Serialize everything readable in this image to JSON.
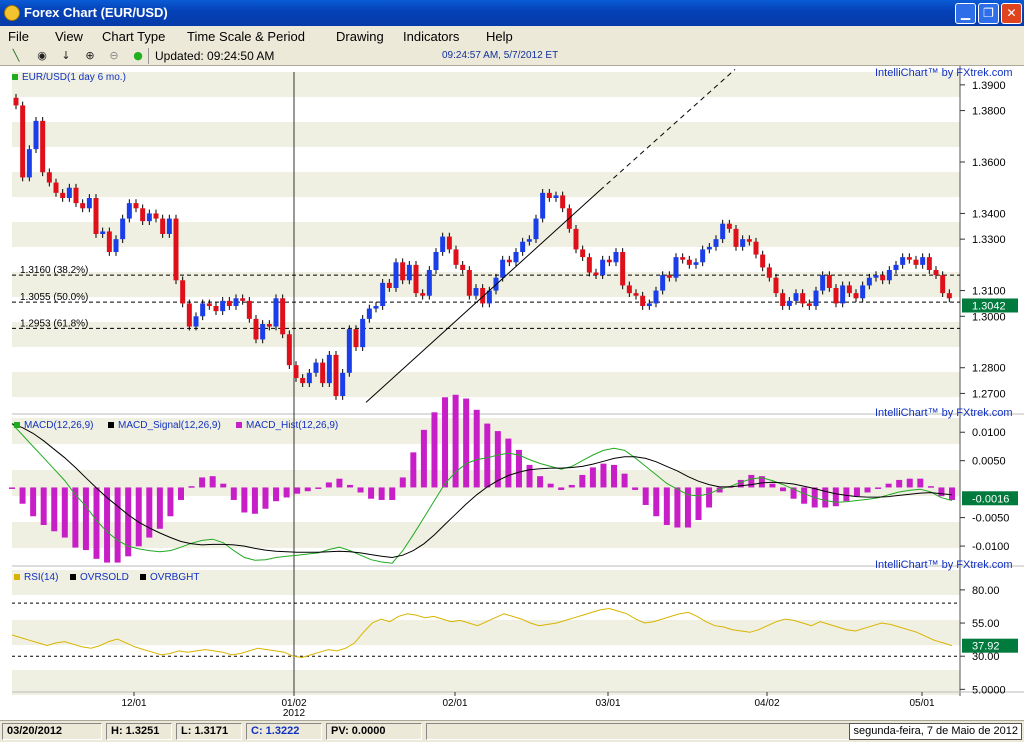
{
  "window": {
    "title": "Forex Chart (EUR/USD)",
    "min_icon": "minimize-icon",
    "max_icon": "maximize-icon",
    "close_icon": "close-icon"
  },
  "menu": [
    "File",
    "View",
    "Chart Type",
    "Time Scale & Period",
    "Drawing",
    "Indicators",
    "Help"
  ],
  "toolbar": {
    "updated": "Updated: 09:24:50 AM",
    "clock": "09:24:57 AM, 5/7/2012 ET",
    "icons": [
      "trendline-icon",
      "crosshair-icon",
      "arrow-down-icon",
      "zoom-in-icon",
      "zoom-out-icon",
      "live-dot-icon"
    ]
  },
  "brand": "IntelliChart™ by FXtrek.com",
  "price_panel": {
    "legend": "EUR/USD(1 day  6 mo.)",
    "fib": [
      "1.3160 (38.2%)",
      "1.3055 (50.0%)",
      "1.2953 (61.8%)"
    ],
    "fib_values": [
      1.316,
      1.3055,
      1.2953
    ],
    "ticks": [
      "1.3900",
      "1.3800",
      "1.3600",
      "1.3400",
      "1.3300",
      "1.3100",
      "1.3000",
      "1.2800",
      "1.2700"
    ],
    "tick_values": [
      1.39,
      1.38,
      1.36,
      1.34,
      1.33,
      1.31,
      1.3,
      1.28,
      1.27
    ],
    "last": "1.3042",
    "last_value": 1.3042
  },
  "macd_panel": {
    "legends": [
      "MACD(12,26,9)",
      "MACD_Signal(12,26,9)",
      "MACD_Hist(12,26,9)"
    ],
    "ticks": [
      "0.0100",
      "0.0050",
      "-0.0050",
      "-0.0100"
    ],
    "tick_values": [
      0.01,
      0.005,
      -0.005,
      -0.01
    ],
    "last": "-0.0016",
    "last_value": -0.0016
  },
  "rsi_panel": {
    "legends": [
      "RSI(14)",
      "OVRSOLD",
      "OVRBGHT"
    ],
    "ticks": [
      "80.00",
      "55.00",
      "30.00",
      "5.0000"
    ],
    "tick_values": [
      80,
      55,
      30,
      5
    ],
    "oversold": 30,
    "overbought": 70,
    "last": "37.92",
    "last_value": 37.92
  },
  "x_axis": {
    "labels": [
      "12/01",
      "01/02",
      "02/01",
      "03/01",
      "04/02",
      "05/01"
    ],
    "year": "2012"
  },
  "colors": {
    "up": "#1a3ee8",
    "down": "#e0101a",
    "macd": "#22aa22",
    "signal": "#000000",
    "hist": "#c81ec8",
    "rsi": "#d8b400",
    "bg_band": "#f0f0e2",
    "accent": "#007a3d"
  },
  "status": {
    "date": "03/20/2012",
    "high": "H: 1.3251",
    "low": "L: 1.3171",
    "close": "C: 1.3222",
    "pv": "PV: 0.0000",
    "footer_date": "segunda-feira, 7 de Maio de 2012"
  },
  "chart_data": {
    "type": "candlestick",
    "closes": [
      1.382,
      1.354,
      1.365,
      1.376,
      1.356,
      1.352,
      1.348,
      1.346,
      1.35,
      1.344,
      1.342,
      1.346,
      1.332,
      1.333,
      1.325,
      1.33,
      1.338,
      1.344,
      1.342,
      1.337,
      1.34,
      1.338,
      1.332,
      1.338,
      1.314,
      1.305,
      1.296,
      1.3,
      1.305,
      1.304,
      1.302,
      1.306,
      1.304,
      1.307,
      1.306,
      1.299,
      1.291,
      1.297,
      1.296,
      1.307,
      1.293,
      1.281,
      1.276,
      1.274,
      1.278,
      1.282,
      1.274,
      1.285,
      1.269,
      1.278,
      1.295,
      1.288,
      1.299,
      1.303,
      1.304,
      1.313,
      1.311,
      1.321,
      1.314,
      1.32,
      1.309,
      1.308,
      1.318,
      1.325,
      1.331,
      1.326,
      1.32,
      1.318,
      1.308,
      1.311,
      1.305,
      1.31,
      1.315,
      1.322,
      1.321,
      1.325,
      1.329,
      1.33,
      1.338,
      1.348,
      1.346,
      1.347,
      1.342,
      1.334,
      1.326,
      1.323,
      1.317,
      1.316,
      1.322,
      1.321,
      1.325,
      1.312,
      1.309,
      1.308,
      1.304,
      1.305,
      1.31,
      1.316,
      1.315,
      1.323,
      1.322,
      1.32,
      1.321,
      1.326,
      1.327,
      1.33,
      1.336,
      1.334,
      1.327,
      1.33,
      1.329,
      1.324,
      1.319,
      1.315,
      1.309,
      1.304,
      1.306,
      1.309,
      1.305,
      1.304,
      1.31,
      1.316,
      1.311,
      1.305,
      1.312,
      1.309,
      1.307,
      1.312,
      1.315,
      1.316,
      1.314,
      1.318,
      1.32,
      1.323,
      1.322,
      1.32,
      1.323,
      1.318,
      1.316,
      1.309,
      1.307
    ],
    "macd": [
      0.0115,
      0.0095,
      0.0075,
      0.0055,
      0.0035,
      0.0015,
      -0.001,
      -0.003,
      -0.0055,
      -0.0075,
      -0.009,
      -0.01,
      -0.0105,
      -0.0108,
      -0.011,
      -0.0108,
      -0.0102,
      -0.0095,
      -0.009,
      -0.0088,
      -0.0094,
      -0.0108,
      -0.012,
      -0.0125,
      -0.0124,
      -0.012,
      -0.0118,
      -0.0116,
      -0.0114,
      -0.0112,
      -0.0106,
      -0.0102,
      -0.0108,
      -0.0116,
      -0.0124,
      -0.0128,
      -0.013,
      -0.0108,
      -0.008,
      -0.005,
      -0.002,
      0.001,
      0.003,
      0.0045,
      0.0052,
      0.0055,
      0.006,
      0.0063,
      0.006,
      0.0052,
      0.0045,
      0.004,
      0.0035,
      0.004,
      0.005,
      0.006,
      0.0068,
      0.0072,
      0.0068,
      0.0055,
      0.004,
      0.0025,
      0.001,
      0.0,
      -0.001,
      -0.0012,
      -0.0008,
      0.0,
      0.0005,
      0.0012,
      0.0018,
      0.002,
      0.0015,
      0.0008,
      0.0,
      -0.0008,
      -0.0015,
      -0.002,
      -0.0023,
      -0.0022,
      -0.002,
      -0.0018,
      -0.0015,
      -0.001,
      -0.0005,
      -0.0002,
      0.0,
      -0.0005,
      -0.0015,
      -0.002
    ],
    "signal": [
      0.0115,
      0.0108,
      0.0098,
      0.0085,
      0.007,
      0.0055,
      0.0038,
      0.002,
      0.0002,
      -0.0015,
      -0.003,
      -0.0045,
      -0.0058,
      -0.0068,
      -0.0077,
      -0.0085,
      -0.0092,
      -0.0096,
      -0.0098,
      -0.0097,
      -0.0097,
      -0.0098,
      -0.01,
      -0.0104,
      -0.0107,
      -0.0109,
      -0.011,
      -0.0111,
      -0.0111,
      -0.0111,
      -0.011,
      -0.0109,
      -0.011,
      -0.0112,
      -0.0115,
      -0.0118,
      -0.012,
      -0.0116,
      -0.0108,
      -0.0096,
      -0.008,
      -0.0062,
      -0.0044,
      -0.0026,
      -0.001,
      0.0004,
      0.0015,
      0.0024,
      0.003,
      0.0034,
      0.0036,
      0.0037,
      0.0037,
      0.0038,
      0.004,
      0.0044,
      0.0049,
      0.0054,
      0.0057,
      0.0057,
      0.0054,
      0.0048,
      0.004,
      0.0032,
      0.0022,
      0.0014,
      0.0008,
      0.0004,
      0.0004,
      0.0006,
      0.0008,
      0.0011,
      0.0012,
      0.0011,
      0.0009,
      0.0005,
      0.0001,
      -0.0004,
      -0.0008,
      -0.0011,
      -0.0013,
      -0.0014,
      -0.0014,
      -0.0013,
      -0.0011,
      -0.0009,
      -0.0007,
      -0.0006,
      -0.0008,
      -0.001
    ],
    "rsi": [
      46,
      44,
      42,
      40,
      38,
      40,
      41,
      39,
      37,
      36,
      38,
      41,
      43,
      40,
      37,
      35,
      33,
      31,
      32,
      34,
      33,
      34,
      35,
      34,
      33,
      31,
      32,
      34,
      36,
      35,
      34,
      33,
      30,
      29,
      31,
      33,
      35,
      34,
      36,
      40,
      48,
      55,
      58,
      56,
      60,
      62,
      61,
      59,
      60,
      58,
      56,
      57,
      55,
      53,
      56,
      59,
      62,
      60,
      58,
      55,
      53,
      54,
      55,
      57,
      59,
      61,
      63,
      65,
      66,
      64,
      62,
      58,
      55,
      56,
      58,
      60,
      62,
      63,
      60,
      56,
      53,
      52,
      50,
      49,
      48,
      50,
      53,
      56,
      58,
      57,
      55,
      53,
      56,
      54,
      52,
      50,
      49,
      51,
      53,
      55,
      54,
      52,
      50,
      48,
      45,
      42,
      40,
      38
    ],
    "x_labels": [
      "12/01",
      "01/02",
      "02/01",
      "03/01",
      "04/02",
      "05/01"
    ]
  }
}
